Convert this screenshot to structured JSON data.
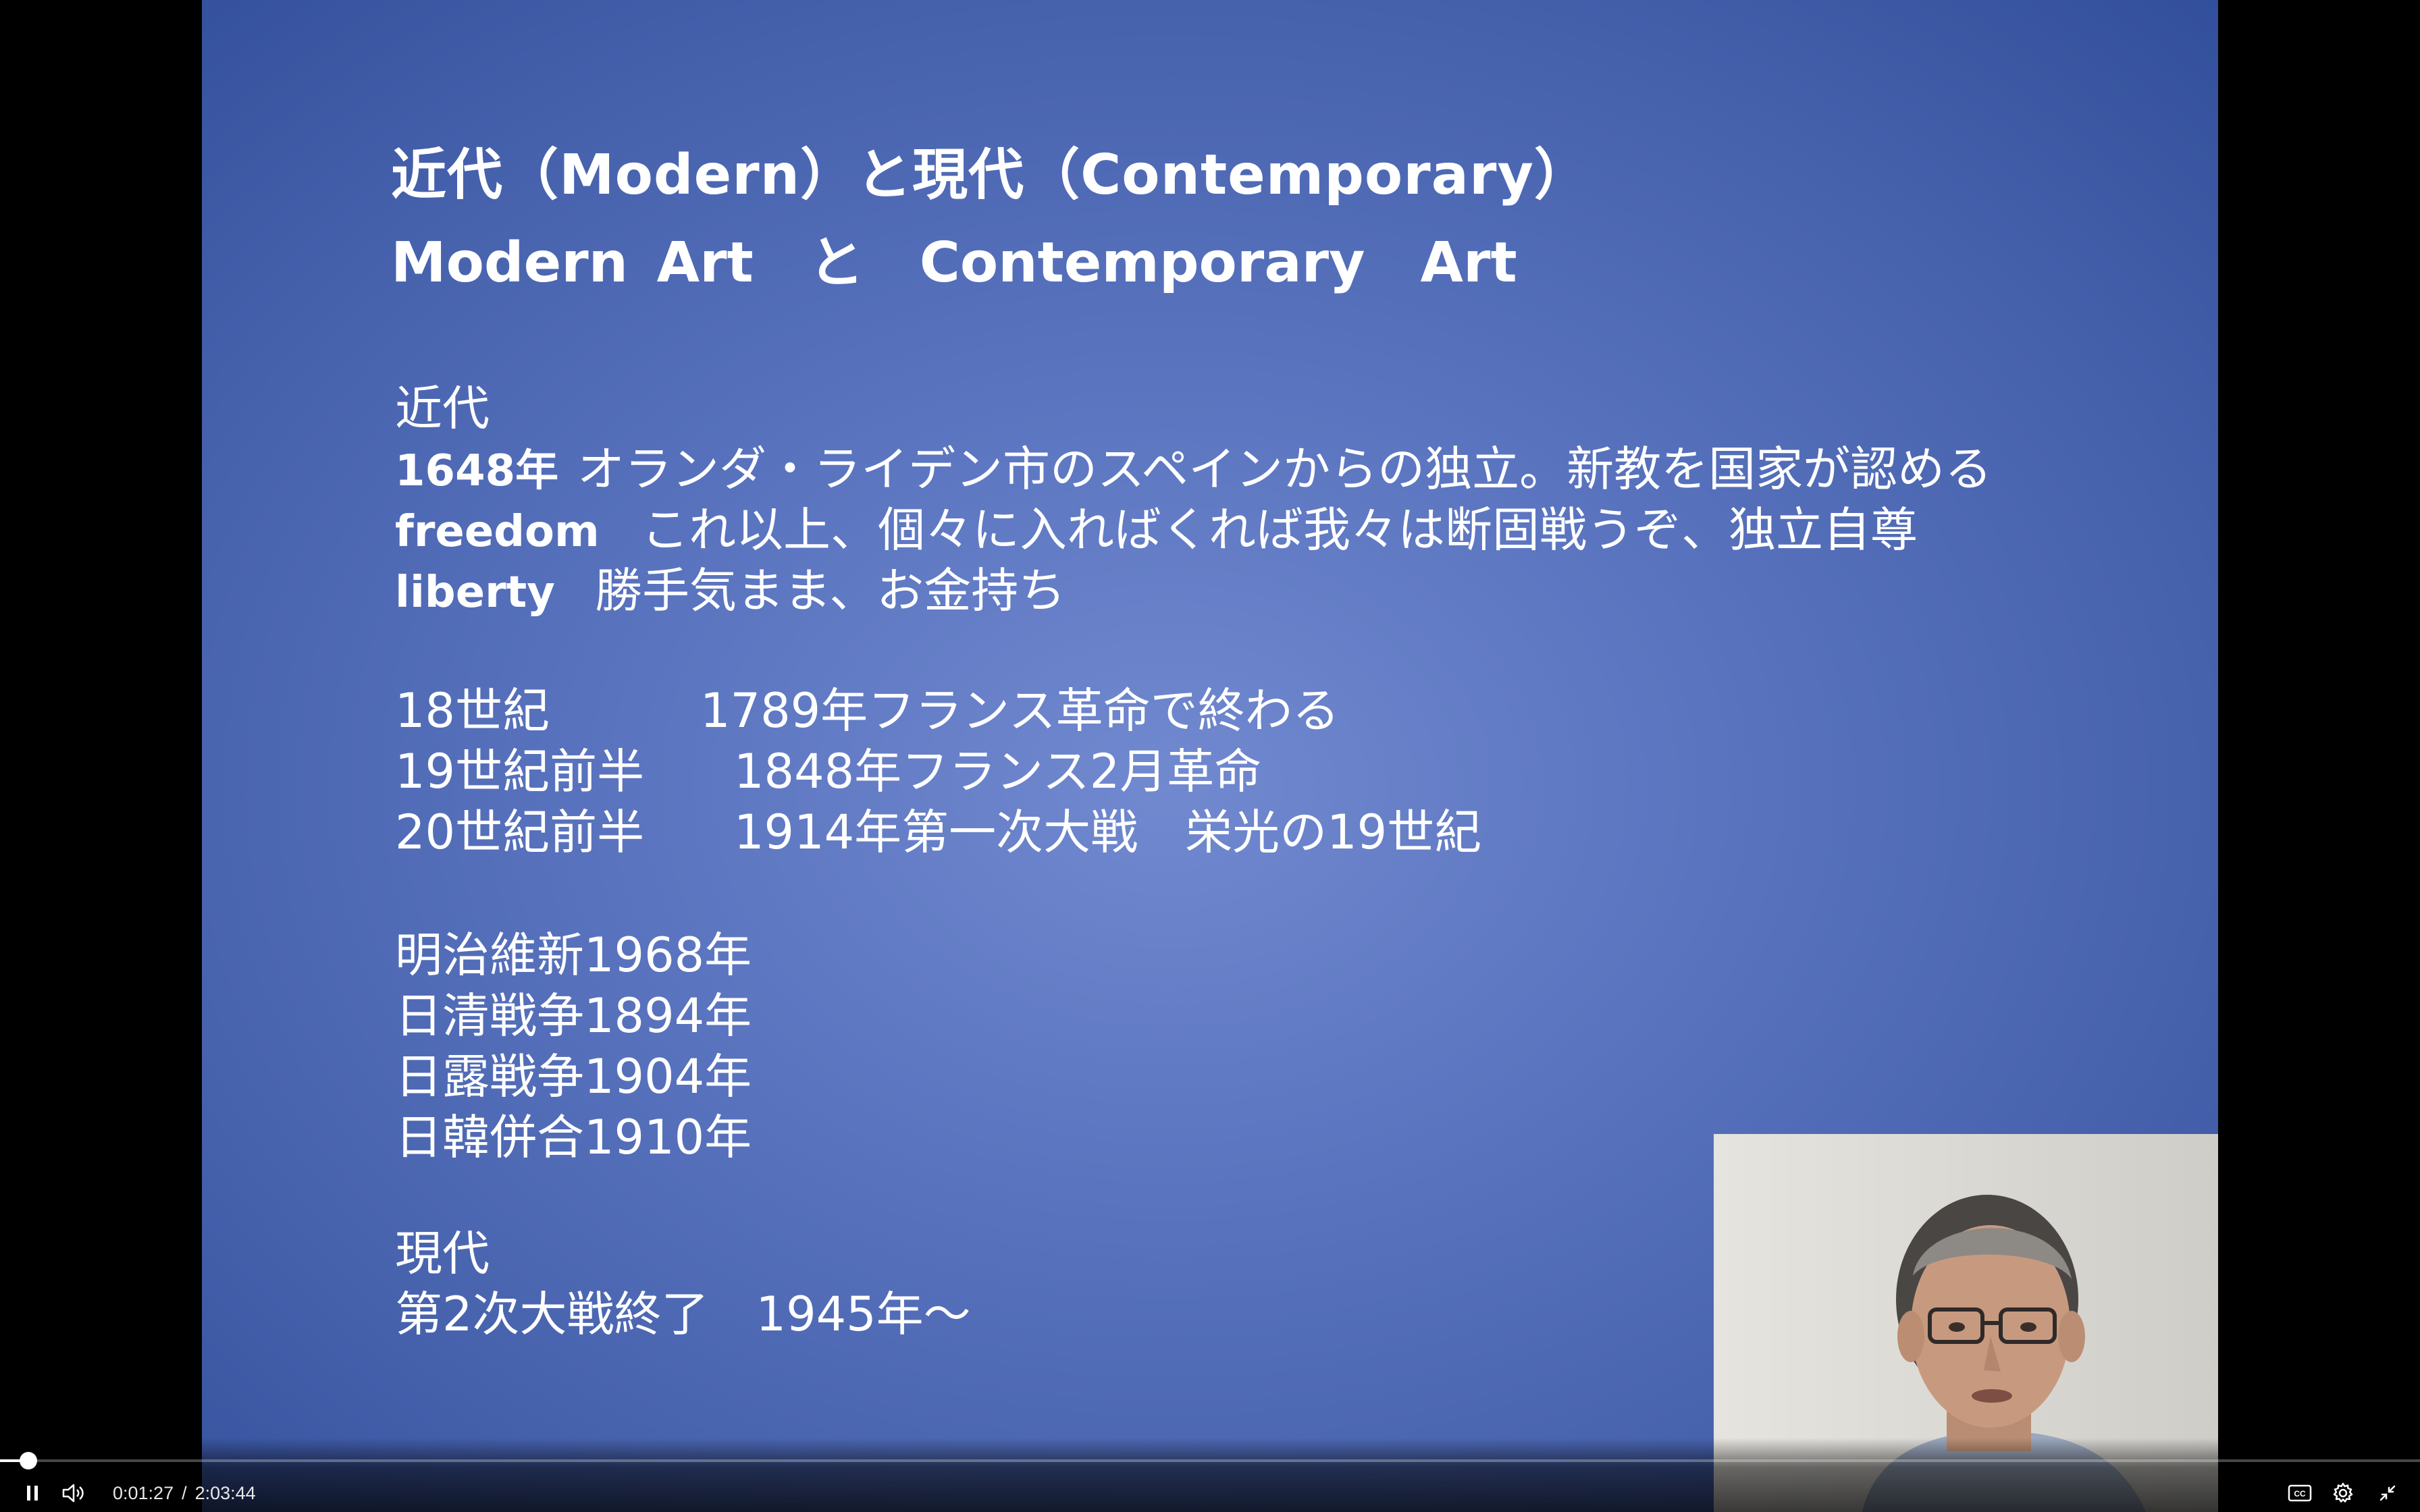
{
  "slide": {
    "title": "近代（Modern）と現代（Contemporary）",
    "subtitle": "Modern Art　と　Contemporary　Art",
    "section_modern_heading": "近代",
    "definitions": [
      {
        "key": "1648年",
        "text": "オランダ・ライデン市のスペインからの独立。新教を国家が認める"
      },
      {
        "key": "freedom",
        "text": "これ以上、個々に入ればくれば我々は断固戦うぞ、独立自尊"
      },
      {
        "key": "liberty",
        "text": "勝手気まま、お金持ち"
      }
    ],
    "eras": [
      {
        "era": "18世紀",
        "event": "1789年フランス革命で終わる"
      },
      {
        "era": "19世紀前半",
        "event": "1848年フランス2月革命"
      },
      {
        "era": "20世紀前半",
        "event": "1914年第一次大戦　栄光の19世紀"
      }
    ],
    "japan_events": [
      "明治維新1968年",
      "日清戦争1894年",
      "日露戦争1904年",
      "日韓併合1910年"
    ],
    "section_contemporary_heading": "現代",
    "contemporary_line": "第2次大戦終了　1945年～"
  },
  "player": {
    "current_time": "0:01:27",
    "time_separator": "/",
    "duration": "2:03:44",
    "progress_fraction": 0.0117,
    "icons": {
      "play_pause": "pause-icon",
      "volume": "volume-icon",
      "captions": "closed-captions-icon",
      "settings": "gear-icon",
      "fullscreen": "exit-fullscreen-icon"
    }
  },
  "colors": {
    "slide_bg": "#5b75c0",
    "slide_text": "#ffffff",
    "player_bg": "#000000"
  }
}
